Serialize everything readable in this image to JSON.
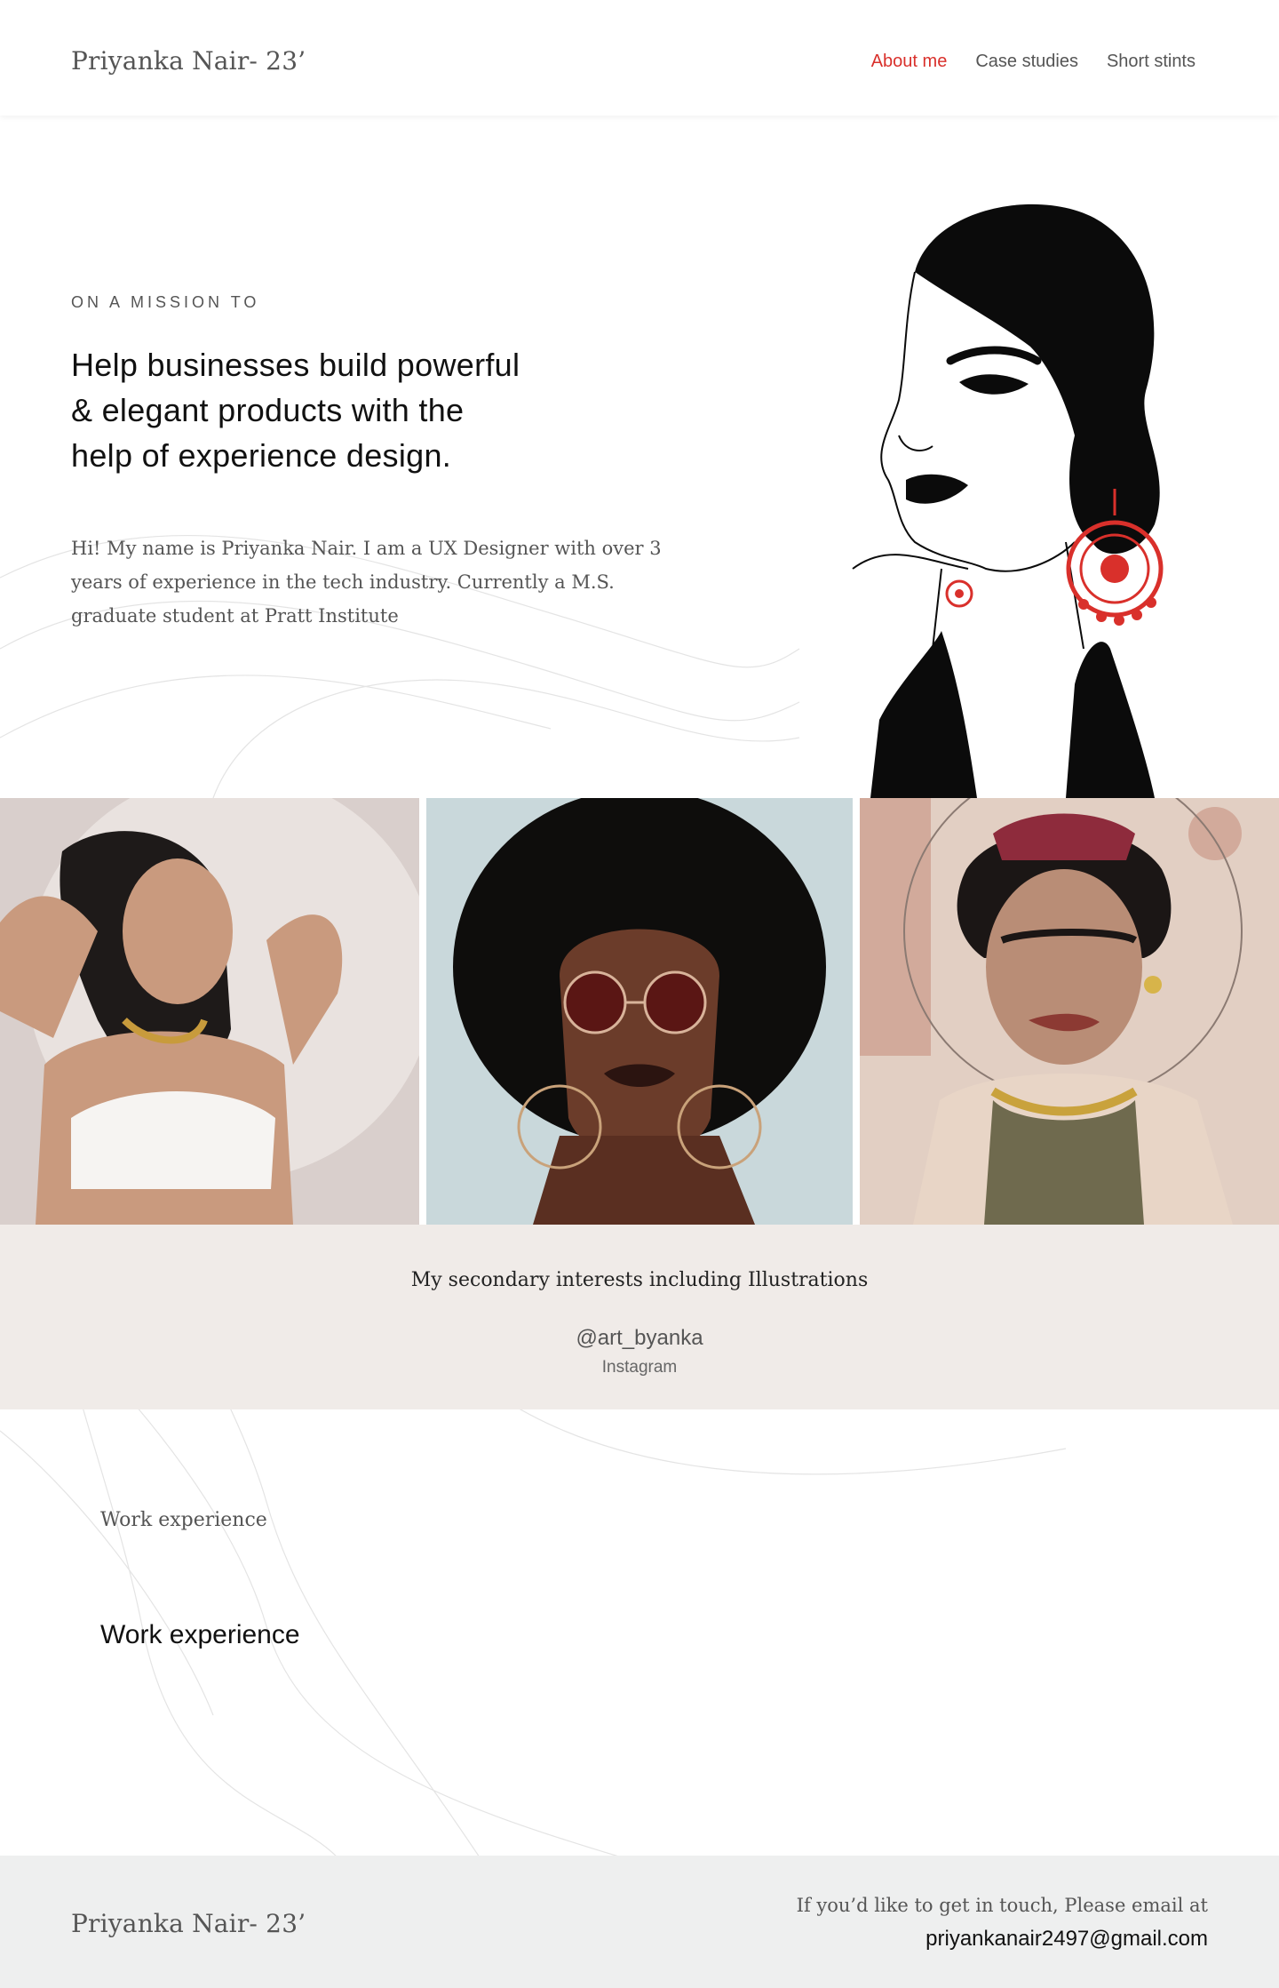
{
  "header": {
    "brand": "Priyanka Nair- 23’",
    "nav": [
      "About me",
      "Case studies",
      "Short stints"
    ],
    "active_nav": "About me"
  },
  "hero": {
    "kicker": "ON A MISSION TO",
    "headline_lines": [
      "Help businesses build powerful",
      "& elegant products with the",
      "help of experience design."
    ],
    "intro_lines": [
      "Hi! My name is Priyanka Nair. I am a UX Designer with over 3",
      "years of experience in the tech industry.  Currently a M.S.",
      "graduate student at Pratt Institute"
    ]
  },
  "gallery": {
    "tiles": [
      {
        "name": "illustration-woman-white-top",
        "bg": "#d9cfcc"
      },
      {
        "name": "illustration-woman-afro",
        "bg": "#c9d8db"
      },
      {
        "name": "illustration-frida",
        "bg": "#e2cfc3"
      }
    ]
  },
  "interests": {
    "line": "My secondary interests including Illustrations",
    "handle": "@art_byanka",
    "platform": "Instagram"
  },
  "work": {
    "small_heading": "Work experience",
    "title": "Work experience"
  },
  "footer": {
    "brand": "Priyanka Nair- 23’",
    "prompt": "If you’d like to get in touch, Please email at",
    "email": "priyankanair2497@gmail.com"
  },
  "colors": {
    "accent": "#d9302b",
    "band": "#f0ebe8",
    "footer": "#eeefef"
  }
}
